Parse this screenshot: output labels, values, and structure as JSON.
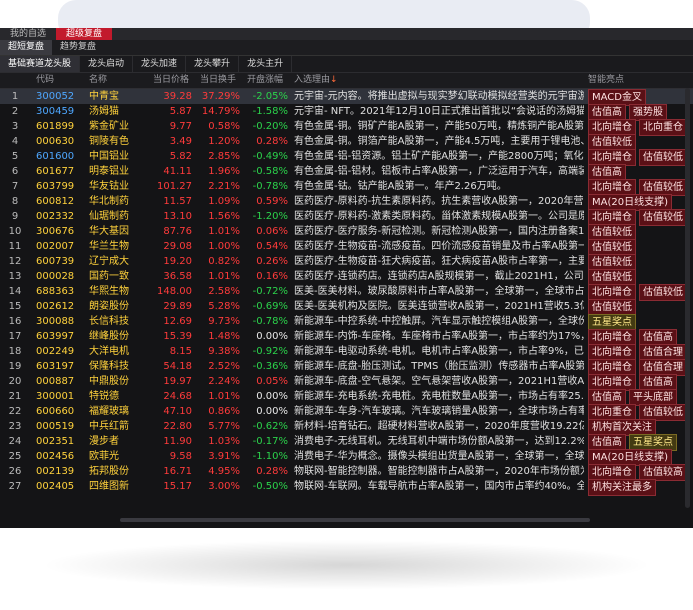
{
  "top_tabs": [
    "我的自选",
    "超级复盘"
  ],
  "sub_tabs": [
    "超短复盘",
    "趋势复盘"
  ],
  "category_tabs": [
    "基础赛道龙头股",
    "龙头启动",
    "龙头加速",
    "龙头攀升",
    "龙头主升"
  ],
  "headers": {
    "code": "代码",
    "name": "名称",
    "price": "当日价格",
    "turnover": "当日换手",
    "change": "开盘涨幅",
    "reason": "入选理由",
    "sort_icon": "↓",
    "tags": "智能亮点"
  },
  "rows": [
    {
      "idx": "1",
      "code": "300052",
      "name": "中青宝",
      "price": "39.28",
      "turnover": "37.29%",
      "change": "-2.05%",
      "reason": "元宇宙-元内容。将推出虚拟与现实梦幻联动模拟经营类的元宇宙游戏《酷",
      "tags": [
        "MACD金叉"
      ]
    },
    {
      "idx": "2",
      "code": "300459",
      "name": "汤姆猫",
      "price": "5.87",
      "turnover": "14.79%",
      "change": "-1.58%",
      "reason": "元宇宙- NFT。2021年12月10日正式推出首批以“会说话的汤姆猫家族”",
      "tags": [
        "估值高",
        "强势股"
      ]
    },
    {
      "idx": "3",
      "code": "601899",
      "name": "紫金矿业",
      "price": "9.77",
      "turnover": "0.58%",
      "change": "-0.20%",
      "reason": "有色金属-铜。铜矿产能A股第一，产能50万吨，精炼铜产能A股第一，",
      "tags": [
        "北向增仓",
        "北向重仓"
      ]
    },
    {
      "idx": "4",
      "code": "000630",
      "name": "铜陵有色",
      "price": "3.49",
      "turnover": "1.20%",
      "change": "0.28%",
      "reason": "有色金属-铜。铜箔产能A股第一，产能4.5万吨，主要用于锂电池、电子",
      "tags": [
        "估值较低"
      ]
    },
    {
      "idx": "5",
      "code": "601600",
      "name": "中国铝业",
      "price": "5.82",
      "turnover": "2.85%",
      "change": "-0.49%",
      "reason": "有色金属-铝-铝资源。铝土矿产能A股第一，产能2800万吨；氧化铝产能A",
      "tags": [
        "北向增仓",
        "估值较低"
      ]
    },
    {
      "idx": "6",
      "code": "601677",
      "name": "明泰铝业",
      "price": "41.11",
      "turnover": "1.96%",
      "change": "-0.58%",
      "reason": "有色金属-铝-铝材。铝板市占率A股第一，广泛运用于汽车，高端装备，",
      "tags": [
        "估值高"
      ]
    },
    {
      "idx": "7",
      "code": "603799",
      "name": "华友钴业",
      "price": "101.27",
      "turnover": "2.21%",
      "change": "-0.78%",
      "reason": "有色金属-钴。钴产能A股第一。年产2.26万吨。",
      "tags": [
        "北向增仓",
        "估值较低"
      ]
    },
    {
      "idx": "8",
      "code": "600812",
      "name": "华北制药",
      "price": "11.57",
      "turnover": "1.09%",
      "change": "0.59%",
      "reason": "医药医疗-原料药-抗生素原料药。抗生素营收A股第一，2020年营收114.9",
      "tags": [
        "MA(20日线支撑)"
      ]
    },
    {
      "idx": "9",
      "code": "002332",
      "name": "仙琚制药",
      "price": "13.10",
      "turnover": "1.56%",
      "change": "-1.20%",
      "reason": "医药医疗-原料药-激素类原料药。甾体激素规模A股第一。公司是原料药和",
      "tags": [
        "北向增仓",
        "估值较低"
      ]
    },
    {
      "idx": "10",
      "code": "300676",
      "name": "华大基因",
      "price": "87.76",
      "turnover": "1.01%",
      "change": "0.06%",
      "reason": "医药医疗-医疗服务-新冠检测。新冠检测A股第一，国内注册备案154项，",
      "tags": [
        "估值较低"
      ]
    },
    {
      "idx": "11",
      "code": "002007",
      "name": "华兰生物",
      "price": "29.08",
      "turnover": "1.00%",
      "change": "0.54%",
      "reason": "医药医疗-生物疫苗-流感疫苗。四价流感疫苗销量及市占率A股第一，",
      "tags": [
        "估值较低"
      ]
    },
    {
      "idx": "12",
      "code": "600739",
      "name": "辽宁成大",
      "price": "19.20",
      "turnover": "0.82%",
      "change": "0.26%",
      "reason": "医药医疗-生物疫苗-狂犬病疫苗。狂犬病疫苗A股市占率第一，主要产品为",
      "tags": [
        "估值较低"
      ]
    },
    {
      "idx": "13",
      "code": "000028",
      "name": "国药一致",
      "price": "36.58",
      "turnover": "1.01%",
      "change": "0.16%",
      "reason": "医药医疗-连锁药店。连锁药店A股规模第一，截止2021H1，公司拥有门店",
      "tags": [
        "估值较低"
      ]
    },
    {
      "idx": "14",
      "code": "688363",
      "name": "华熙生物",
      "price": "148.00",
      "turnover": "2.58%",
      "change": "-0.72%",
      "reason": "医美-医美材料。玻尿酸原料市占率A股第一，全球第一，全球市占率为",
      "tags": [
        "北向增仓",
        "估值较低"
      ]
    },
    {
      "idx": "15",
      "code": "002612",
      "name": "朗姿股份",
      "price": "29.89",
      "turnover": "5.28%",
      "change": "-0.69%",
      "reason": "医美-医美机构及医院。医美连锁营收A股第一，2021H1营收5.3亿，占比",
      "tags": [
        "估值较低"
      ]
    },
    {
      "idx": "16",
      "code": "300088",
      "name": "长信科技",
      "price": "12.69",
      "turnover": "9.73%",
      "change": "-0.78%",
      "reason": "新能源车-中控系统-中控触屏。汽车显示触控模组A股第一，全球份额约",
      "tags": [
        "五星奖点"
      ]
    },
    {
      "idx": "17",
      "code": "603997",
      "name": "继峰股份",
      "price": "15.39",
      "turnover": "1.48%",
      "change": "0.00%",
      "reason": "新能源车-内饰-车座椅。车座椅市占率A股第一，市占率约为17%，主要有",
      "tags": [
        "北向增仓",
        "估值高"
      ]
    },
    {
      "idx": "18",
      "code": "002249",
      "name": "大洋电机",
      "price": "8.15",
      "turnover": "9.38%",
      "change": "-0.92%",
      "reason": "新能源车-电驱动系统-电机。电机市占率A股第一，市占率9%，已形成了",
      "tags": [
        "北向增仓",
        "估值合理"
      ]
    },
    {
      "idx": "19",
      "code": "603197",
      "name": "保隆科技",
      "price": "54.18",
      "turnover": "2.52%",
      "change": "-0.36%",
      "reason": "新能源车-底盘-胎压测试。TPMS（胎压监测）传感器市占率A股第一，全",
      "tags": [
        "北向增仓",
        "估值合理"
      ]
    },
    {
      "idx": "20",
      "code": "000887",
      "name": "中鼎股份",
      "price": "19.97",
      "turnover": "2.24%",
      "change": "0.05%",
      "reason": "新能源车-底盘-空气悬架。空气悬架营收A股第一，2021H1营收A股2.96",
      "tags": [
        "北向增仓",
        "估值高"
      ]
    },
    {
      "idx": "21",
      "code": "300001",
      "name": "特锐德",
      "price": "24.68",
      "turnover": "1.01%",
      "change": "0.00%",
      "reason": "新能源车-充电系统-充电桩。充电桩数量A股第一，市场占有率25.7%，",
      "tags": [
        "估值高",
        "平头底部"
      ]
    },
    {
      "idx": "22",
      "code": "600660",
      "name": "福耀玻璃",
      "price": "47.10",
      "turnover": "0.86%",
      "change": "0.00%",
      "reason": "新能源车-车身-汽车玻璃。汽车玻璃销量A股第一，全球市场占有率31%，",
      "tags": [
        "北向重仓",
        "估值较低"
      ]
    },
    {
      "idx": "23",
      "code": "000519",
      "name": "中兵红箭",
      "price": "22.80",
      "turnover": "5.77%",
      "change": "-0.62%",
      "reason": "新材料-培育钻石。超硬材料营收A股第一，2020年度营收19.22亿元，",
      "tags": [
        "机构首次关注"
      ]
    },
    {
      "idx": "24",
      "code": "002351",
      "name": "漫步者",
      "price": "11.90",
      "turnover": "1.03%",
      "change": "-0.17%",
      "reason": "消费电子-无线耳机。无线耳机中端市场份额A股第一，达到12.2%。国内中",
      "tags": [
        "估值高",
        "五星奖点"
      ]
    },
    {
      "idx": "25",
      "code": "002456",
      "name": "欧菲光",
      "price": "9.58",
      "turnover": "3.91%",
      "change": "-1.10%",
      "reason": "消费电子-华为概念。摄像头模组出货量A股第一，全球第一，全球市占率",
      "tags": [
        "MA(20日线支撑)"
      ]
    },
    {
      "idx": "26",
      "code": "002139",
      "name": "拓邦股份",
      "price": "16.71",
      "turnover": "4.95%",
      "change": "0.28%",
      "reason": "物联网-智能控制器。智能控制器市占A股第一，2020年市场份额为0.23",
      "tags": [
        "北向增仓",
        "估值较高"
      ]
    },
    {
      "idx": "27",
      "code": "002405",
      "name": "四维图新",
      "price": "15.17",
      "turnover": "3.00%",
      "change": "-0.50%",
      "reason": "物联网-车联网。车载导航市占率A股第一，国内市占率约40%。全球前五",
      "tags": [
        "机构关注最多"
      ]
    }
  ],
  "colors": {
    "selected_tab": "#c21a2c",
    "up": "#ff3b3b",
    "down": "#2bd24b",
    "code_blue": "#4ea7ff",
    "name_gold": "#ffd23c"
  }
}
